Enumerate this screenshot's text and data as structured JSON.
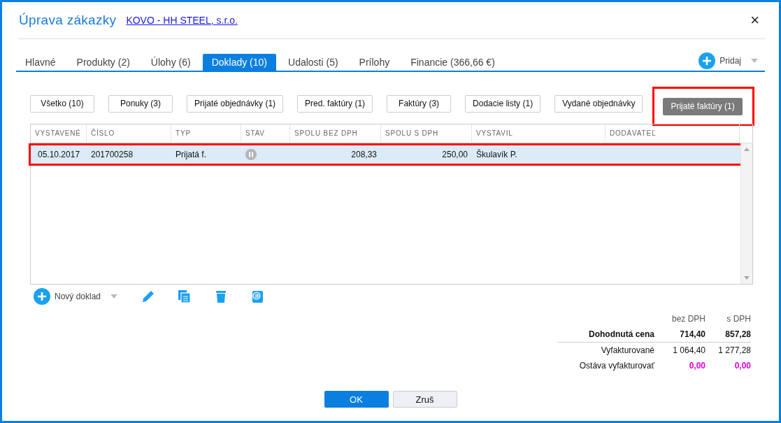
{
  "window": {
    "title": "Úprava zákazky",
    "link": "KOVO - HH STEEL, s.r.o.",
    "close": "×"
  },
  "tabs": [
    {
      "label": "Hlavné",
      "selected": false
    },
    {
      "label": "Produkty (2)",
      "selected": false
    },
    {
      "label": "Úlohy (6)",
      "selected": false
    },
    {
      "label": "Doklady (10)",
      "selected": true
    },
    {
      "label": "Udalosti (5)",
      "selected": false
    },
    {
      "label": "Prílohy",
      "selected": false
    },
    {
      "label": "Financie (366,66 €)",
      "selected": false
    }
  ],
  "add_button": {
    "label": "Pridaj"
  },
  "filters": [
    {
      "label": "Všetko (10)",
      "selected": false,
      "highlighted": false
    },
    {
      "label": "Ponuky (3)",
      "selected": false,
      "highlighted": false
    },
    {
      "label": "Prijaté objednávky (1)",
      "selected": false,
      "highlighted": false
    },
    {
      "label": "Pred. faktúry (1)",
      "selected": false,
      "highlighted": false
    },
    {
      "label": "Faktúry (3)",
      "selected": false,
      "highlighted": false
    },
    {
      "label": "Dodacie listy (1)",
      "selected": false,
      "highlighted": false
    },
    {
      "label": "Vydané objednávky",
      "selected": false,
      "highlighted": false
    },
    {
      "label": "Prijaté faktúry (1)",
      "selected": true,
      "highlighted": true
    }
  ],
  "table": {
    "columns": [
      "VYSTAVENÉ",
      "ČÍSLO",
      "TYP",
      "STAV",
      "SPOLU BEZ DPH",
      "SPOLU S DPH",
      "VYSTAVIL",
      "DODÁVATEĽ"
    ],
    "rows": [
      {
        "date": "05.10.2017",
        "number": "201700258",
        "type": "Prijatá f.",
        "paused": true,
        "net": "208,33",
        "gross": "250,00",
        "issued_by": "Škulavík P.",
        "selected": true,
        "highlighted": true
      }
    ]
  },
  "toolbar": {
    "new_label": "Nový doklad"
  },
  "summary": {
    "headers": [
      "bez DPH",
      "s DPH"
    ],
    "rows": [
      {
        "label": "Dohodnutá cena",
        "net": "714,40",
        "gross": "857,28",
        "kind": "bold"
      },
      {
        "label": "Vyfakturované",
        "net": "1 064,40",
        "gross": "1 277,28",
        "kind": "normal"
      },
      {
        "label": "Ostáva vyfakturovať",
        "net": "0,00",
        "gross": "0,00",
        "kind": "remaining"
      }
    ]
  },
  "buttons": {
    "ok": "OK",
    "cancel": "Zruš"
  }
}
